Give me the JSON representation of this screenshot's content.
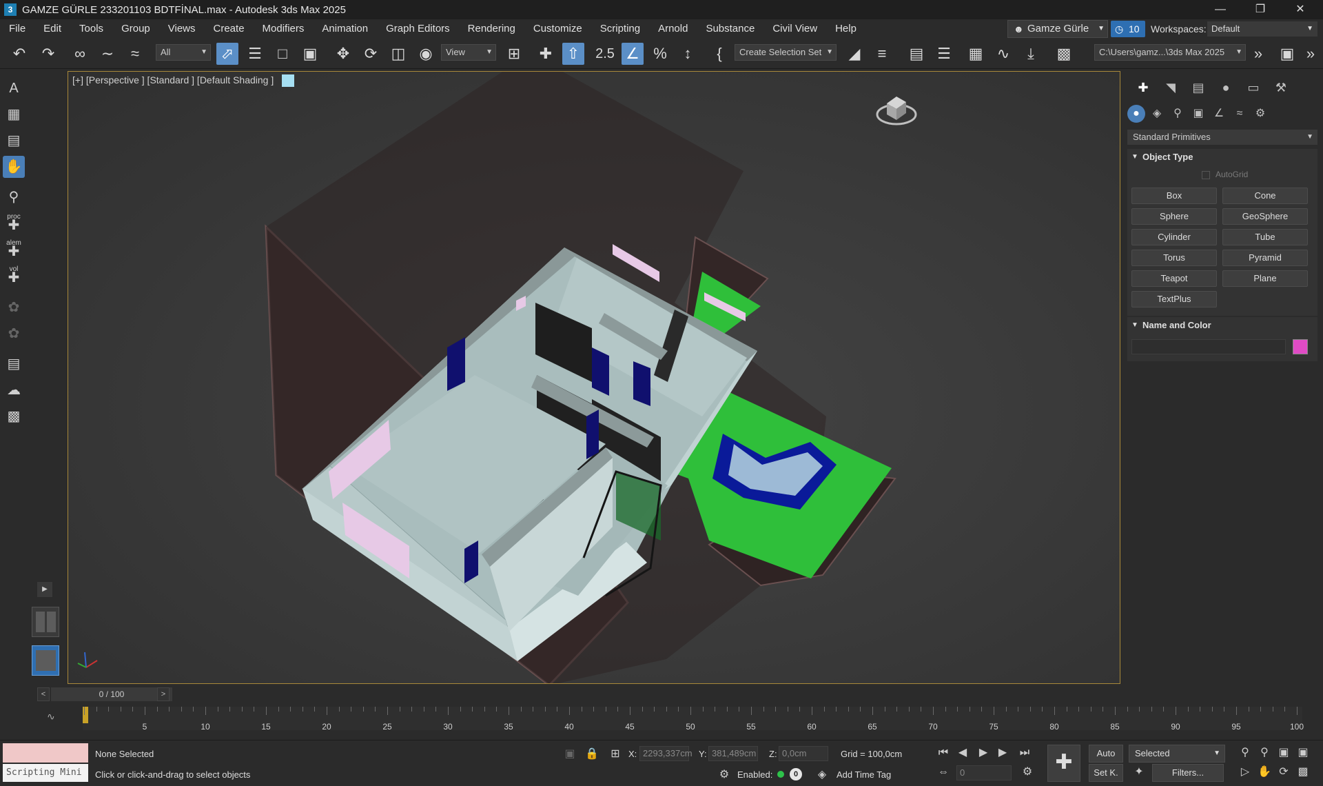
{
  "app": {
    "title": "GAMZE GÜRLE 233201103 BDTFİNAL.max - Autodesk 3ds Max 2025",
    "icon_letter": "3"
  },
  "menu": [
    "File",
    "Edit",
    "Tools",
    "Group",
    "Views",
    "Create",
    "Modifiers",
    "Animation",
    "Graph Editors",
    "Rendering",
    "Customize",
    "Scripting",
    "Arnold",
    "Substance",
    "Civil View",
    "Help"
  ],
  "account": {
    "user": "Gamze Gürle",
    "notifications": "10",
    "workspaces_label": "Workspaces:",
    "workspace": "Default"
  },
  "toolbar": {
    "filter": "All",
    "ref_coord": "View",
    "snap_value": "2.5",
    "selection_set": "Create Selection Set",
    "project_path": "C:\\Users\\gamz...\\3ds Max 2025"
  },
  "left_strip": {
    "proc": "proc",
    "alem": "alem",
    "vol": "vol"
  },
  "viewport": {
    "label": "[+] [Perspective ] [Standard ] [Default Shading ]",
    "colors": {
      "wall": "#b7c9c9",
      "floor": "#a9bdbd",
      "grass": "#2fbf3a",
      "pool": "#0a1a99",
      "window": "#e7c9e6"
    }
  },
  "command_panel": {
    "category": "Standard Primitives",
    "object_type_title": "Object Type",
    "autogrid": "AutoGrid",
    "primitives": [
      "Box",
      "Cone",
      "Sphere",
      "GeoSphere",
      "Cylinder",
      "Tube",
      "Torus",
      "Pyramid",
      "Teapot",
      "Plane",
      "TextPlus"
    ],
    "name_color_title": "Name and Color",
    "object_color": "#e04bc5"
  },
  "timeline": {
    "position": "0 / 100",
    "current_frame": 0,
    "labels": [
      "5",
      "10",
      "15",
      "20",
      "25",
      "30",
      "35",
      "40",
      "45",
      "50",
      "55",
      "60",
      "65",
      "70",
      "75",
      "80",
      "85",
      "90",
      "95",
      "100"
    ]
  },
  "status": {
    "selection": "None Selected",
    "prompt": "Click or click-and-drag to select objects",
    "script_field": "Scripting Mini",
    "x_label": "X:",
    "x": "2293,337cm",
    "y_label": "Y:",
    "y": "381,489cm",
    "z_label": "Z:",
    "z": "0,0cm",
    "grid": "Grid = 100,0cm",
    "enabled_label": "Enabled:",
    "enabled_value": "0",
    "add_time_tag": "Add Time Tag",
    "auto": "Auto",
    "set_key": "Set K.",
    "key_filter": "Selected",
    "filters": "Filters...",
    "frame_field": "0"
  }
}
